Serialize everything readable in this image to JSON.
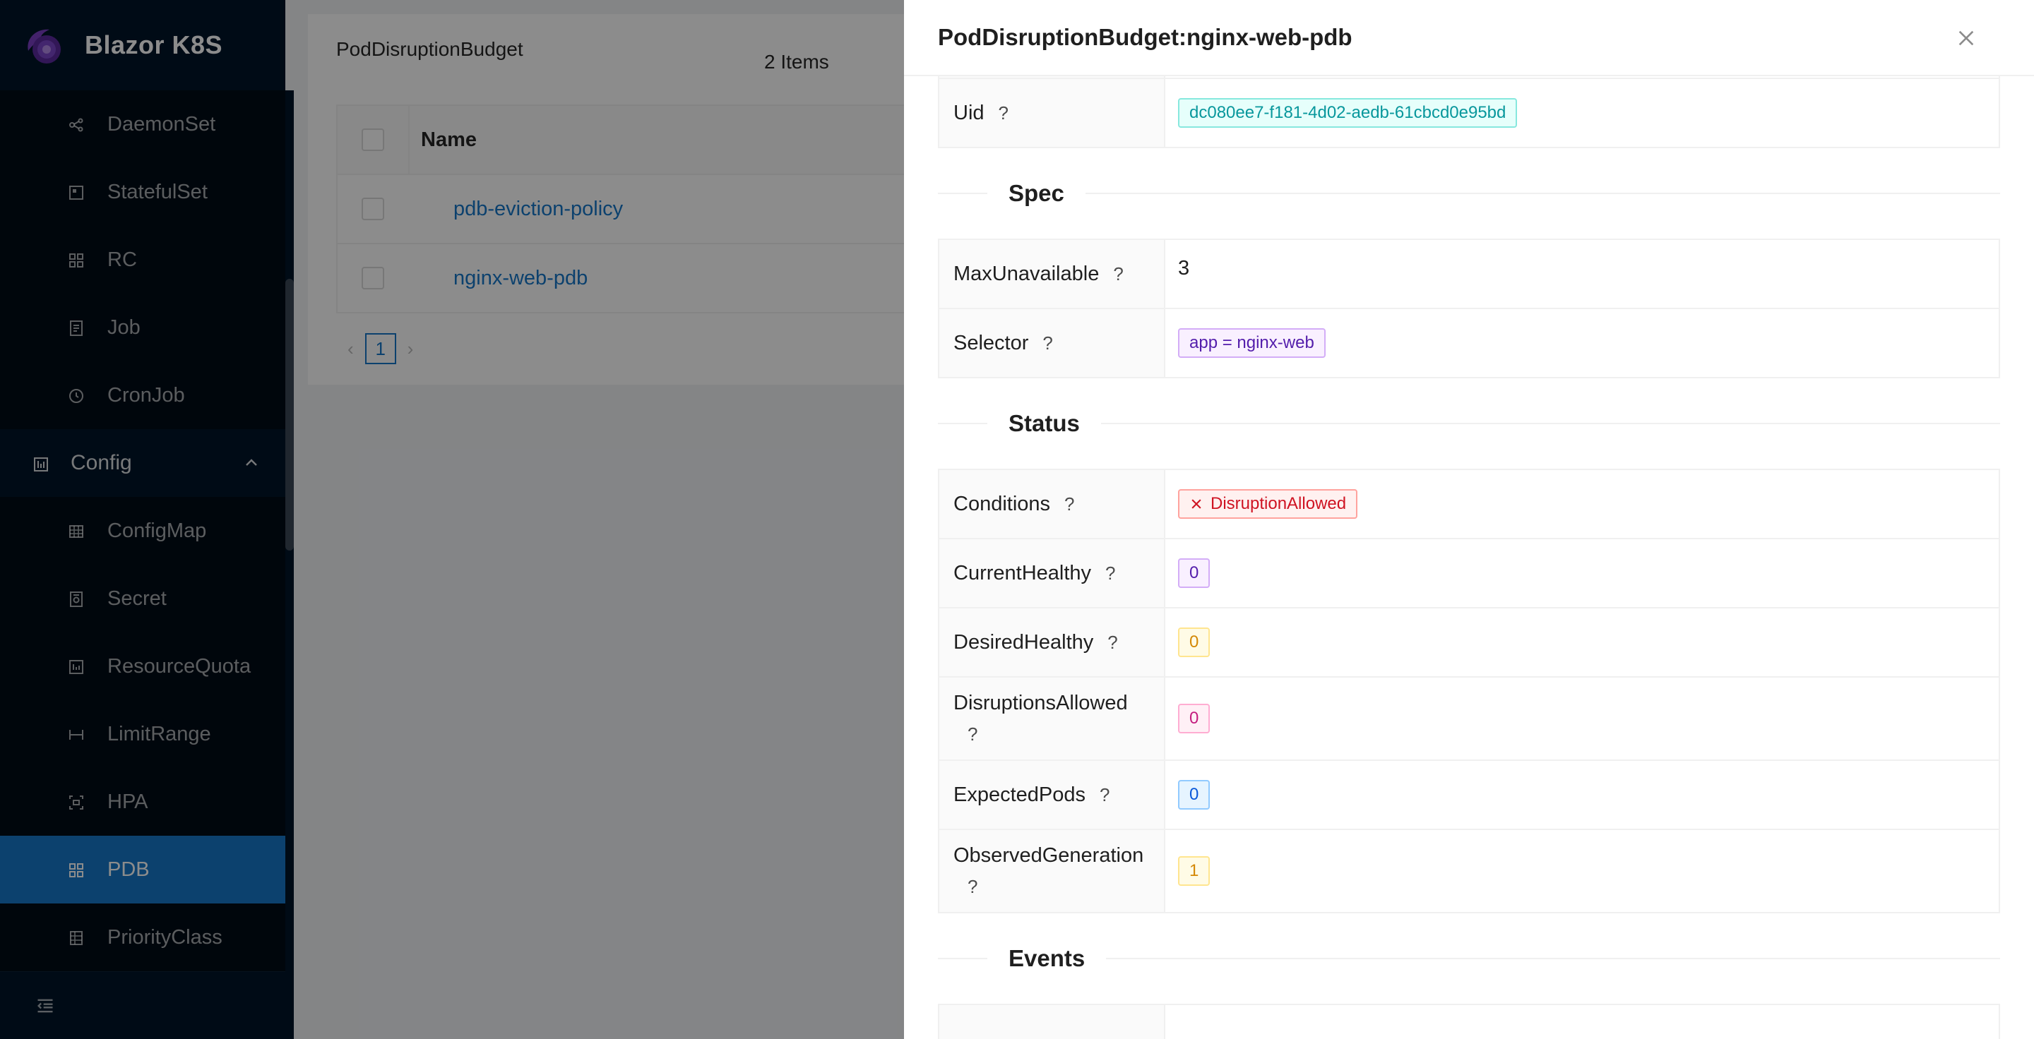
{
  "app": {
    "title": "Blazor K8S"
  },
  "sidebar": {
    "items": [
      {
        "label": "DaemonSet",
        "icon": "daemonset-icon"
      },
      {
        "label": "StatefulSet",
        "icon": "statefulset-icon"
      },
      {
        "label": "RC",
        "icon": "rc-icon"
      },
      {
        "label": "Job",
        "icon": "job-icon"
      },
      {
        "label": "CronJob",
        "icon": "clock-icon"
      }
    ],
    "group": {
      "label": "Config",
      "icon": "config-icon"
    },
    "config_items": [
      {
        "label": "ConfigMap",
        "icon": "table-icon"
      },
      {
        "label": "Secret",
        "icon": "secret-icon"
      },
      {
        "label": "ResourceQuota",
        "icon": "quota-icon"
      },
      {
        "label": "LimitRange",
        "icon": "limitrange-icon"
      },
      {
        "label": "HPA",
        "icon": "hpa-icon"
      },
      {
        "label": "PDB",
        "icon": "pdb-icon",
        "active": true
      },
      {
        "label": "PriorityClass",
        "icon": "priorityclass-icon"
      }
    ]
  },
  "list": {
    "title": "PodDisruptionBudget",
    "count": "2 Items",
    "column_name": "Name",
    "rows": [
      {
        "name": "pdb-eviction-policy"
      },
      {
        "name": "nginx-web-pdb"
      }
    ],
    "page": "1"
  },
  "drawer": {
    "title": "PodDisruptionBudget:nginx-web-pdb",
    "metadata": {
      "uid_label": "Uid",
      "uid_value": "dc080ee7-f181-4d02-aedb-61cbcd0e95bd"
    },
    "spec": {
      "title": "Spec",
      "max_unavailable_label": "MaxUnavailable",
      "max_unavailable_value": "3",
      "selector_label": "Selector",
      "selector_value": "app = nginx-web"
    },
    "status": {
      "title": "Status",
      "conditions_label": "Conditions",
      "conditions_value": "DisruptionAllowed",
      "current_healthy_label": "CurrentHealthy",
      "current_healthy_value": "0",
      "desired_healthy_label": "DesiredHealthy",
      "desired_healthy_value": "0",
      "disruptions_allowed_label": "DisruptionsAllowed",
      "disruptions_allowed_value": "0",
      "expected_pods_label": "ExpectedPods",
      "expected_pods_value": "0",
      "observed_generation_label": "ObservedGeneration",
      "observed_generation_value": "1"
    },
    "events": {
      "title": "Events"
    },
    "help_glyph": "?"
  },
  "colors": {
    "sidebar_bg": "#001529",
    "active": "#1677c8"
  }
}
